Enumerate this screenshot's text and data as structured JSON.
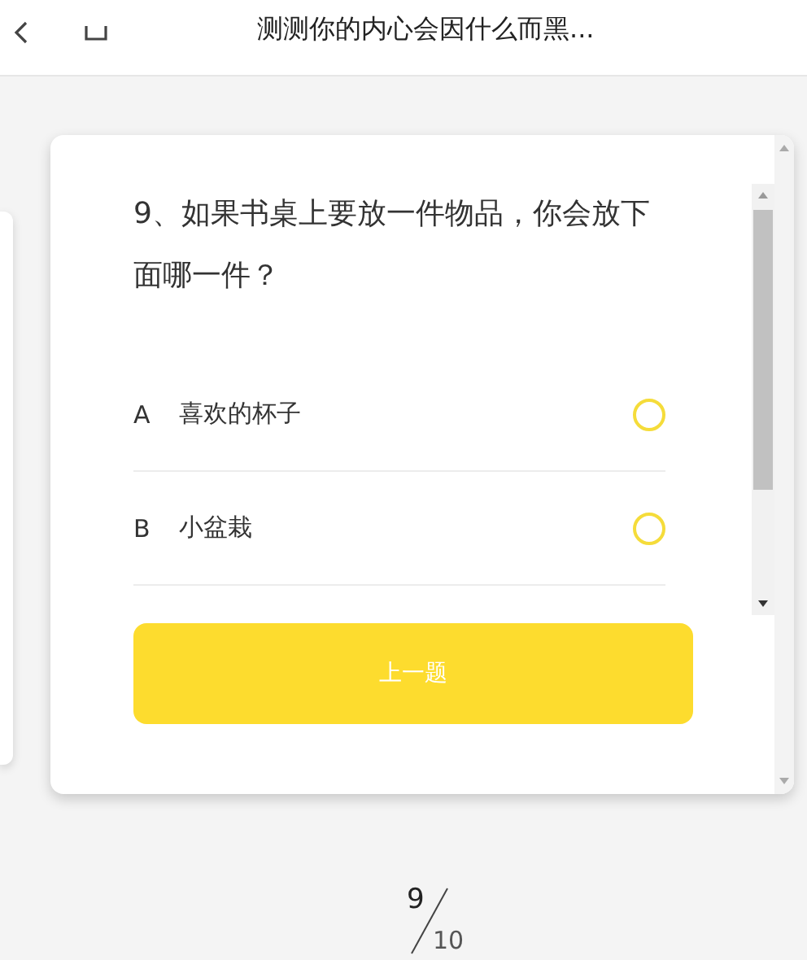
{
  "header": {
    "title": "测测你的内心会因什么而黑..."
  },
  "question": {
    "text": "9、如果书桌上要放一件物品，你会放下面哪一件？",
    "options": [
      {
        "letter": "A",
        "text": "喜欢的杯子",
        "selected": false
      },
      {
        "letter": "B",
        "text": "小盆栽",
        "selected": false
      }
    ]
  },
  "buttons": {
    "previous": "上一题"
  },
  "progress": {
    "current": "9",
    "total": "10"
  }
}
